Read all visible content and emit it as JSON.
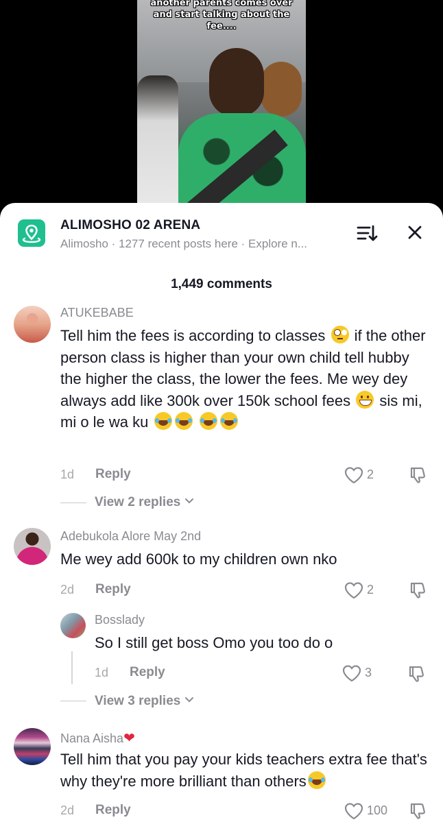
{
  "video": {
    "caption_line1": "another parents comes over",
    "caption_line2": "and start talking about the",
    "caption_line3": "fee...."
  },
  "header": {
    "location_title": "ALIMOSHO 02 ARENA",
    "location_subtitle": "Alimosho · 1277 recent posts here · Explore n...",
    "icons": {
      "location": "location-pin-icon",
      "sort": "sort-icon",
      "close": "close-icon"
    }
  },
  "comments_count": "1,449 comments",
  "comments": [
    {
      "username": "ATUKEBABE",
      "text_part1": "Tell him the fees is according to classes ",
      "text_part2": " if the other person class is higher than your own child tell hubby the higher the class, the lower the fees. Me wey dey always add like 300k over 150k school fees ",
      "text_part3": " sis mi, mi o le wa ku ",
      "time": "1d",
      "reply_label": "Reply",
      "likes": "2",
      "view_replies": "View 2 replies"
    },
    {
      "username": "Adebukola Alore May 2nd",
      "text": "Me wey add 600k to my children own nko",
      "time": "2d",
      "reply_label": "Reply",
      "likes": "2",
      "reply": {
        "username": "Bosslady",
        "text": "So I still get boss Omo you too do o",
        "time": "1d",
        "reply_label": "Reply",
        "likes": "3"
      },
      "view_replies": "View 3 replies"
    },
    {
      "username": "Nana Aisha",
      "text": "Tell him that you pay your kids teachers extra fee that's why they're more brilliant than others",
      "time": "2d",
      "reply_label": "Reply",
      "likes": "100"
    }
  ],
  "colors": {
    "accent_green": "#1fbf8f",
    "text_primary": "#161823",
    "text_secondary": "#8a8b91"
  }
}
